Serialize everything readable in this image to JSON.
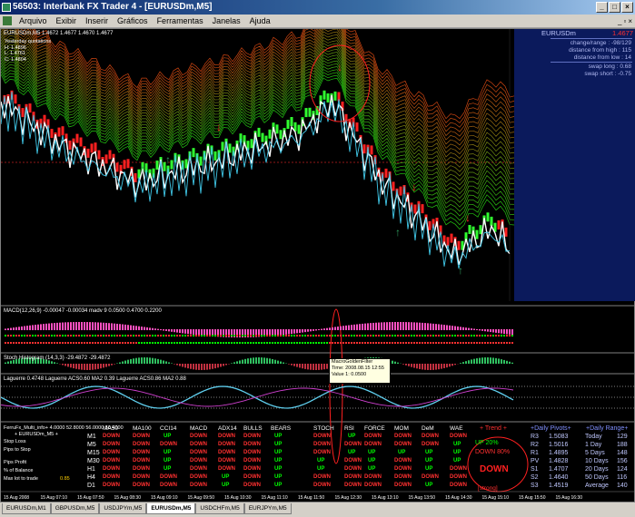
{
  "window": {
    "title": "56503: Interbank FX Trader 4 - [EURUSDm,M5]"
  },
  "menu": [
    "Arquivo",
    "Exibir",
    "Inserir",
    "Gráficos",
    "Ferramentas",
    "Janelas",
    "Ajuda"
  ],
  "chart": {
    "symbol_info": "EURUSDm,M5 1.4672 1.4677 1.4670 1.4677",
    "yesterday": {
      "title": "Yesterday quotations",
      "h": "H: 1.4896",
      "l": "L: 1.4761",
      "c": "C: 1.4804"
    }
  },
  "infobox": {
    "symbol": "EURUSDm",
    "price": "1.4677",
    "change_range": "change/range : -98/129",
    "from_high": "distance from high : 115",
    "from_low": "distance from low : 14",
    "swap_long": "swap long : 0.68",
    "swap_short": "swap short : -0.75"
  },
  "panels": {
    "macd": "MACD(12,26,9) -0.00047 -0.00034 madv 9 0.0500 0.4700 0.2200",
    "stoch": "Stoch Histogram (14,3,3) -29.4872 -29.4872",
    "laguerre": "Laguerre 0.4748 Laguerre ACS0.60 MA2 0.39 Laguerre ACS0.86 MA2 0.88"
  },
  "tooltip": {
    "name": "MacroGoldenFilter",
    "time": "Time: 2008.08.15 12:55",
    "value": "Value 1: 0.0500"
  },
  "grid": {
    "title": "FerruFx_Multi_info+ 4.0000 52.8000 56.0000 50.4000",
    "subtitle": "+ EURUSDm_M5 +",
    "headers": [
      "MA50",
      "MA100",
      "CCI14",
      "MACD",
      "ADX14",
      "BULLS",
      "BEARS",
      "STOCH",
      "RSI",
      "FORCE",
      "MOM",
      "DeM",
      "WAE"
    ],
    "timeframes": [
      "M1",
      "M5",
      "M15",
      "M30",
      "H1",
      "H4",
      "D1"
    ],
    "rows": [
      [
        "DOWN",
        "DOWN",
        "UP",
        "DOWN",
        "DOWN",
        "DOWN",
        "UP",
        "DOWN",
        "UP",
        "DOWN",
        "DOWN",
        "DOWN",
        "DOWN"
      ],
      [
        "DOWN",
        "DOWN",
        "DOWN",
        "DOWN",
        "DOWN",
        "DOWN",
        "UP",
        "DOWN",
        "DOWN",
        "DOWN",
        "DOWN",
        "DOWN",
        "UP"
      ],
      [
        "DOWN",
        "DOWN",
        "UP",
        "DOWN",
        "DOWN",
        "DOWN",
        "UP",
        "DOWN",
        "UP",
        "UP",
        "UP",
        "UP",
        "UP"
      ],
      [
        "DOWN",
        "DOWN",
        "UP",
        "DOWN",
        "DOWN",
        "DOWN",
        "UP",
        "UP",
        "DOWN",
        "UP",
        "DOWN",
        "UP",
        "UP"
      ],
      [
        "DOWN",
        "DOWN",
        "UP",
        "DOWN",
        "DOWN",
        "DOWN",
        "UP",
        "UP",
        "DOWN",
        "UP",
        "DOWN",
        "UP",
        "DOWN"
      ],
      [
        "DOWN",
        "DOWN",
        "DOWN",
        "DOWN",
        "UP",
        "DOWN",
        "UP",
        "DOWN",
        "DOWN",
        "DOWN",
        "DOWN",
        "DOWN",
        "DOWN"
      ],
      [
        "DOWN",
        "DOWN",
        "DOWN",
        "DOWN",
        "UP",
        "DOWN",
        "UP",
        "DOWN",
        "DOWN",
        "DOWN",
        "DOWN",
        "UP",
        "DOWN"
      ]
    ],
    "left_labels": [
      "Stop Loss",
      "Pips to Stop",
      "Pips Profit",
      "% of Balance",
      "Max lot to trade"
    ],
    "max_lot": "0.85",
    "trend_title": "+ Trend +",
    "trend_up": "UP      20%",
    "trend_down": "DOWN   80%",
    "trend_big": "DOWN",
    "trend_strength": "[strong]",
    "pivots_title": "+Daily Pivots+",
    "pivots": [
      [
        "R3",
        "1.5083"
      ],
      [
        "R2",
        "1.5016"
      ],
      [
        "R1",
        "1.4895"
      ],
      [
        "PV",
        "1.4828"
      ],
      [
        "S1",
        "1.4707"
      ],
      [
        "S2",
        "1.4640"
      ],
      [
        "S3",
        "1.4519"
      ]
    ],
    "range_title": "+Daily Range+",
    "ranges": [
      [
        "Today",
        "129"
      ],
      [
        "1 Day",
        "188"
      ],
      [
        "5 Days",
        "148"
      ],
      [
        "10 Days",
        "156"
      ],
      [
        "20 Days",
        "124"
      ],
      [
        "50 Days",
        "116"
      ],
      [
        "Average",
        "140"
      ]
    ]
  },
  "time_axis": [
    "15 Aug 2008",
    "15 Aug 07:10",
    "15 Aug 07:50",
    "15 Aug 08:30",
    "15 Aug 09:10",
    "15 Aug 09:50",
    "15 Aug 10:30",
    "15 Aug 11:10",
    "15 Aug 11:50",
    "15 Aug 12:30",
    "15 Aug 13:10",
    "15 Aug 13:50",
    "15 Aug 14:30",
    "15 Aug 15:10",
    "15 Aug 15:50",
    "15 Aug 16:30"
  ],
  "tabs": [
    "EURUSDm,M1",
    "GBPUSDm,M5",
    "USDJPYm,M5",
    "EURUSDm,M5",
    "USDCHFm,M5",
    "EURJPYm,M5"
  ],
  "active_tab": "EURUSDm,M5",
  "colors": {
    "up": "#00ff00",
    "down": "#ff3030",
    "infobg": "#0b1a5c"
  }
}
